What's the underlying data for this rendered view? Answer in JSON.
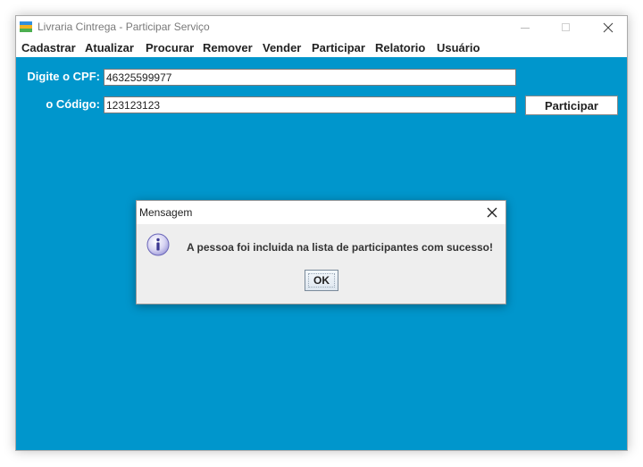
{
  "window": {
    "title": "Livraria Cintrega - Participar Serviço"
  },
  "menubar": {
    "items": [
      "Cadastrar",
      "Atualizar",
      "Procurar",
      "Remover",
      "Vender",
      "Participar",
      "Relatorio",
      "Usuário"
    ]
  },
  "form": {
    "cpf_label": "Digite o CPF:",
    "cpf_value": "46325599977",
    "codigo_label": "o Código:",
    "codigo_value": "123123123",
    "participar_button": "Participar"
  },
  "dialog": {
    "title": "Mensagem",
    "message": "A pessoa foi incluida na lista de participantes com sucesso!",
    "ok_button": "OK",
    "icon": "info-icon"
  },
  "colors": {
    "content_background": "#0096cc",
    "dialog_background": "#eeeeee"
  }
}
